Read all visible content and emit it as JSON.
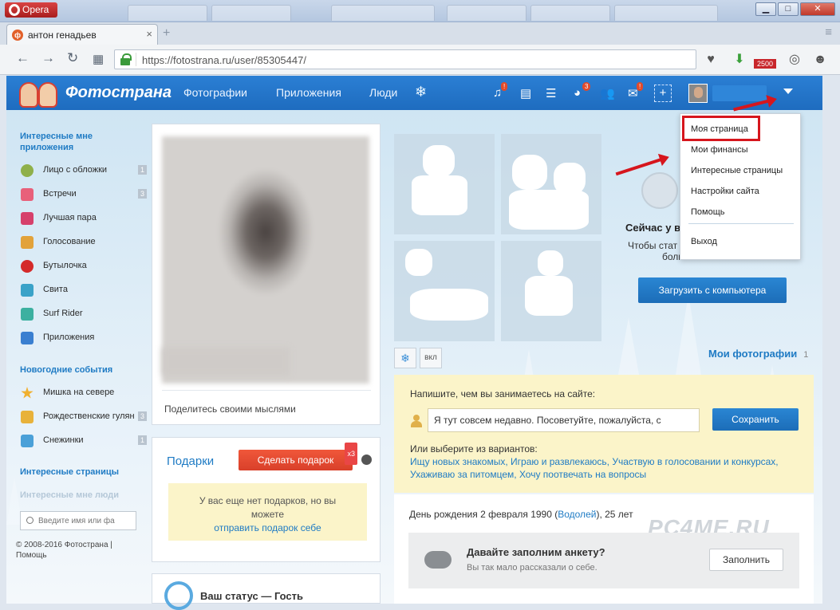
{
  "browser": {
    "app_name": "Opera",
    "tab_title": "антон генадьев",
    "tab_favicon_letter": "ф",
    "url": "https://fotostrana.ru/user/85305447/",
    "ext_counter": "2500",
    "window_controls": [
      "▁",
      "□",
      "✕"
    ]
  },
  "site": {
    "logo": "Фотострана",
    "nav": [
      "Фотографии",
      "Приложения",
      "Люди"
    ],
    "header_badges": {
      "music": "!",
      "games": "3",
      "mail": "!"
    }
  },
  "left": {
    "apps_heading": "Интересные мне приложения",
    "apps": [
      {
        "label": "Лицо с обложки",
        "count": "1",
        "icon": "medal-icon",
        "color": "#8fb04a"
      },
      {
        "label": "Встречи",
        "count": "3",
        "icon": "heart-icon",
        "color": "#e8607a"
      },
      {
        "label": "Лучшая пара",
        "count": "",
        "icon": "couple-heart-icon",
        "color": "#d6406b"
      },
      {
        "label": "Голосование",
        "count": "",
        "icon": "crown-icon",
        "color": "#e2a23a"
      },
      {
        "label": "Бутылочка",
        "count": "",
        "icon": "bottle-heart-icon",
        "color": "#d42a2a"
      },
      {
        "label": "Свита",
        "count": "",
        "icon": "crown-blue-icon",
        "color": "#3aa2c8"
      },
      {
        "label": "Surf Rider",
        "count": "",
        "icon": "surf-icon",
        "color": "#3cb0a0"
      },
      {
        "label": "Приложения",
        "count": "",
        "icon": "gamepad-icon",
        "color": "#3a7fd0"
      }
    ],
    "events_heading": "Новогодние события",
    "events": [
      {
        "label": "Мишка на севере",
        "count": "",
        "icon": "star-icon",
        "color": "#f0b030"
      },
      {
        "label": "Рождественские гулян",
        "count": "3",
        "icon": "snowflake-gold-icon",
        "color": "#e8b23a"
      },
      {
        "label": "Снежинки",
        "count": "1",
        "icon": "snowflake-icon",
        "color": "#4aa0d8"
      }
    ],
    "pages_heading": "Интересные страницы",
    "people_heading": "Интересные мне люди",
    "search_placeholder": "Введите имя или фа",
    "copyright": "© 2008-2016 Фотострана |",
    "help": "Помощь"
  },
  "profile": {
    "share_thoughts": "Поделитесь своими мыслями",
    "gifts_title": "Подарки",
    "gift_button": "Сделать подарок",
    "gift_multiplier": "x3",
    "no_gifts_line1": "У вас еще нет подарков, но вы",
    "no_gifts_line2": "можете",
    "send_gift_self": "отправить подарок себе",
    "status_label": "Ваш статус — Гость"
  },
  "photos": {
    "toggle_label": "вкл",
    "no_photos_title": "Сейчас у в",
    "no_photos_text_1": "Чтобы стат",
    "no_photos_text_2": "боль",
    "upload_button": "Загрузить с компьютера",
    "my_photos": "Мои фотографии",
    "my_photos_count": "1"
  },
  "activity": {
    "question": "Напишите, чем вы занимаетесь на сайте:",
    "input_value": "Я тут совсем недавно. Посоветуйте, пожалуйста, с",
    "save_button": "Сохранить",
    "or_choose": "Или выберите из вариантов:",
    "options": [
      "Ищу новых знакомых",
      "Играю и развлекаюсь",
      "Участвую в голосовании и конкурсах",
      "Ухаживаю за питомцем",
      "Хочу поотвечать на вопросы"
    ]
  },
  "about": {
    "birthday_prefix": "День рождения 2 февраля 1990 (",
    "zodiac": "Водолей",
    "birthday_suffix": "), 25 лет",
    "fill_title": "Давайте заполним анкету?",
    "fill_sub": "Вы так мало рассказали о себе.",
    "fill_button": "Заполнить"
  },
  "dropdown": {
    "items": [
      "Моя страница",
      "Мои финансы",
      "Интересные страницы",
      "Настройки сайта",
      "Помощь"
    ],
    "logout": "Выход"
  },
  "watermark": "PC4ME.RU"
}
